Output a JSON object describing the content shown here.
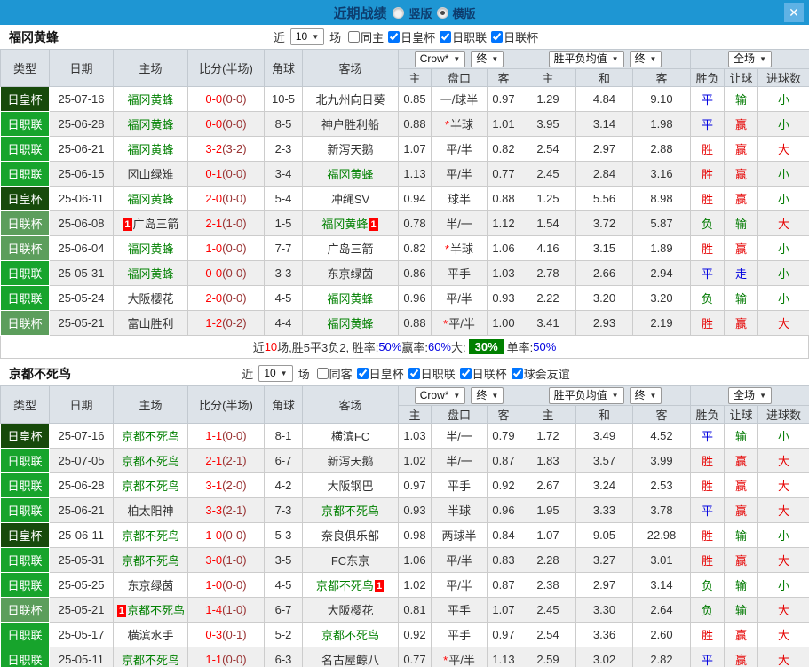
{
  "titlebar": {
    "title": "近期战绩",
    "vertical_label": "竖版",
    "horizontal_label": "横版",
    "selected_layout": "横版",
    "close_glyph": "✕"
  },
  "colors": {
    "titlebar_bg": "#1E96D3",
    "close_button_bg": "#5FB2E5",
    "emperor_cup_bg": "#174A0B",
    "j1_league_bg": "#17A42C",
    "league_cup_bg": "#5C9E5C",
    "team_highlight_green": "#008000",
    "fulltime_score_red": "#FF0000",
    "halftime_score_maroon": "#993333",
    "win_red": "#E60000",
    "draw_blue": "#0000E0",
    "lose_green": "#007A00",
    "odds_column_bg": "#FDF8EF",
    "avg_column_bg": "#E8F2F9",
    "header_bg": "#DDE3E9",
    "stripe_gray": "#EFEFEF",
    "summary_highlight_bg": "#008000"
  },
  "table_header": {
    "main_cols": [
      "类型",
      "日期",
      "主场",
      "比分(半场)",
      "角球",
      "客场"
    ],
    "groups": [
      {
        "name": "odds",
        "dropdown": "Crow*",
        "dropdown2": "终",
        "subs": [
          "主",
          "盘口",
          "客"
        ]
      },
      {
        "name": "avg",
        "dropdown": "胜平负均值",
        "dropdown2": "终",
        "subs": [
          "主",
          "和",
          "客"
        ]
      },
      {
        "name": "scope",
        "dropdown": "全场",
        "dropdown2": null,
        "subs": [
          "胜负",
          "让球",
          "进球数"
        ]
      }
    ]
  },
  "sections": [
    {
      "team": "福冈黄蜂",
      "filter": {
        "near_label": "近",
        "count": "10",
        "unit_label": "场",
        "same": {
          "label": "同主",
          "checked": false
        },
        "leagues": [
          {
            "label": "日皇杯",
            "checked": true
          },
          {
            "label": "日职联",
            "checked": true
          },
          {
            "label": "日联杯",
            "checked": true
          }
        ]
      },
      "rows": [
        {
          "lc": "cup",
          "league": "日皇杯",
          "date": "25-07-16",
          "home": {
            "n": "福冈黄蜂",
            "g": true
          },
          "ft": "0-0",
          "ht": "(0-0)",
          "cn": "10-5",
          "away": {
            "n": "北九州向日葵",
            "g": false
          },
          "o1": "0.85",
          "pk": "一/球半",
          "pks": false,
          "o2": "0.97",
          "a1": "1.29",
          "a2": "4.84",
          "a3": "9.10",
          "r1": {
            "t": "平",
            "c": "b"
          },
          "r2": {
            "t": "输",
            "c": "g"
          },
          "r3": {
            "t": "小",
            "c": "g"
          }
        },
        {
          "lc": "jzl",
          "league": "日职联",
          "date": "25-06-28",
          "home": {
            "n": "福冈黄蜂",
            "g": true
          },
          "ft": "0-0",
          "ht": "(0-0)",
          "cn": "8-5",
          "away": {
            "n": "神户胜利船",
            "g": false
          },
          "o1": "0.88",
          "pk": "半球",
          "pks": true,
          "o2": "1.01",
          "a1": "3.95",
          "a2": "3.14",
          "a3": "1.98",
          "r1": {
            "t": "平",
            "c": "b"
          },
          "r2": {
            "t": "赢",
            "c": "r"
          },
          "r3": {
            "t": "小",
            "c": "g"
          }
        },
        {
          "lc": "jzl",
          "league": "日职联",
          "date": "25-06-21",
          "home": {
            "n": "福冈黄蜂",
            "g": true
          },
          "ft": "3-2",
          "ht": "(3-2)",
          "cn": "2-3",
          "away": {
            "n": "新泻天鹅",
            "g": false
          },
          "o1": "1.07",
          "pk": "平/半",
          "pks": false,
          "o2": "0.82",
          "a1": "2.54",
          "a2": "2.97",
          "a3": "2.88",
          "r1": {
            "t": "胜",
            "c": "r"
          },
          "r2": {
            "t": "赢",
            "c": "r"
          },
          "r3": {
            "t": "大",
            "c": "r"
          }
        },
        {
          "lc": "jzl",
          "league": "日职联",
          "date": "25-06-15",
          "home": {
            "n": "冈山绿雉",
            "g": false
          },
          "ft": "0-1",
          "ht": "(0-0)",
          "cn": "3-4",
          "away": {
            "n": "福冈黄蜂",
            "g": true
          },
          "o1": "1.13",
          "pk": "平/半",
          "pks": false,
          "o2": "0.77",
          "a1": "2.45",
          "a2": "2.84",
          "a3": "3.16",
          "r1": {
            "t": "胜",
            "c": "r"
          },
          "r2": {
            "t": "赢",
            "c": "r"
          },
          "r3": {
            "t": "小",
            "c": "g"
          }
        },
        {
          "lc": "cup",
          "league": "日皇杯",
          "date": "25-06-11",
          "home": {
            "n": "福冈黄蜂",
            "g": true
          },
          "ft": "2-0",
          "ht": "(0-0)",
          "cn": "5-4",
          "away": {
            "n": "冲绳SV",
            "g": false
          },
          "o1": "0.94",
          "pk": "球半",
          "pks": false,
          "o2": "0.88",
          "a1": "1.25",
          "a2": "5.56",
          "a3": "8.98",
          "r1": {
            "t": "胜",
            "c": "r"
          },
          "r2": {
            "t": "赢",
            "c": "r"
          },
          "r3": {
            "t": "小",
            "c": "g"
          }
        },
        {
          "lc": "jlb",
          "league": "日联杯",
          "date": "25-06-08",
          "home": {
            "n": "广岛三箭",
            "g": false,
            "b": "1"
          },
          "ft": "2-1",
          "ht": "(1-0)",
          "cn": "1-5",
          "away": {
            "n": "福冈黄蜂",
            "g": true,
            "b": "1"
          },
          "o1": "0.78",
          "pk": "半/一",
          "pks": false,
          "o2": "1.12",
          "a1": "1.54",
          "a2": "3.72",
          "a3": "5.87",
          "r1": {
            "t": "负",
            "c": "g"
          },
          "r2": {
            "t": "输",
            "c": "g"
          },
          "r3": {
            "t": "大",
            "c": "r"
          }
        },
        {
          "lc": "jlb",
          "league": "日联杯",
          "date": "25-06-04",
          "home": {
            "n": "福冈黄蜂",
            "g": true
          },
          "ft": "1-0",
          "ht": "(0-0)",
          "cn": "7-7",
          "away": {
            "n": "广岛三箭",
            "g": false
          },
          "o1": "0.82",
          "pk": "半球",
          "pks": true,
          "o2": "1.06",
          "a1": "4.16",
          "a2": "3.15",
          "a3": "1.89",
          "r1": {
            "t": "胜",
            "c": "r"
          },
          "r2": {
            "t": "赢",
            "c": "r"
          },
          "r3": {
            "t": "小",
            "c": "g"
          }
        },
        {
          "lc": "jzl",
          "league": "日职联",
          "date": "25-05-31",
          "home": {
            "n": "福冈黄蜂",
            "g": true
          },
          "ft": "0-0",
          "ht": "(0-0)",
          "cn": "3-3",
          "away": {
            "n": "东京绿茵",
            "g": false
          },
          "o1": "0.86",
          "pk": "平手",
          "pks": false,
          "o2": "1.03",
          "a1": "2.78",
          "a2": "2.66",
          "a3": "2.94",
          "r1": {
            "t": "平",
            "c": "b"
          },
          "r2": {
            "t": "走",
            "c": "b"
          },
          "r3": {
            "t": "小",
            "c": "g"
          }
        },
        {
          "lc": "jzl",
          "league": "日职联",
          "date": "25-05-24",
          "home": {
            "n": "大阪樱花",
            "g": false
          },
          "ft": "2-0",
          "ht": "(0-0)",
          "cn": "4-5",
          "away": {
            "n": "福冈黄蜂",
            "g": true
          },
          "o1": "0.96",
          "pk": "平/半",
          "pks": false,
          "o2": "0.93",
          "a1": "2.22",
          "a2": "3.20",
          "a3": "3.20",
          "r1": {
            "t": "负",
            "c": "g"
          },
          "r2": {
            "t": "输",
            "c": "g"
          },
          "r3": {
            "t": "小",
            "c": "g"
          }
        },
        {
          "lc": "jlb",
          "league": "日联杯",
          "date": "25-05-21",
          "home": {
            "n": "富山胜利",
            "g": false
          },
          "ft": "1-2",
          "ht": "(0-2)",
          "cn": "4-4",
          "away": {
            "n": "福冈黄蜂",
            "g": true
          },
          "o1": "0.88",
          "pk": "平/半",
          "pks": true,
          "o2": "1.00",
          "a1": "3.41",
          "a2": "2.93",
          "a3": "2.19",
          "r1": {
            "t": "胜",
            "c": "r"
          },
          "r2": {
            "t": "赢",
            "c": "r"
          },
          "r3": {
            "t": "大",
            "c": "r"
          }
        }
      ],
      "summary": [
        {
          "t": "近",
          "c": "k"
        },
        {
          "t": "10",
          "c": "r"
        },
        {
          "t": "场,胜5平3负2, 胜率:",
          "c": "k"
        },
        {
          "t": "50%",
          "c": "b"
        },
        {
          "t": " 赢率:",
          "c": "k"
        },
        {
          "t": "60%",
          "c": "b"
        },
        {
          "t": " 大:",
          "c": "k"
        },
        {
          "t": "30%",
          "c": "gb"
        },
        {
          "t": " 单率:",
          "c": "k"
        },
        {
          "t": "50%",
          "c": "b"
        }
      ]
    },
    {
      "team": "京都不死鸟",
      "filter": {
        "near_label": "近",
        "count": "10",
        "unit_label": "场",
        "same": {
          "label": "同客",
          "checked": false
        },
        "leagues": [
          {
            "label": "日皇杯",
            "checked": true
          },
          {
            "label": "日职联",
            "checked": true
          },
          {
            "label": "日联杯",
            "checked": true
          },
          {
            "label": "球会友谊",
            "checked": true
          }
        ]
      },
      "rows": [
        {
          "lc": "cup",
          "league": "日皇杯",
          "date": "25-07-16",
          "home": {
            "n": "京都不死鸟",
            "g": true
          },
          "ft": "1-1",
          "ht": "(0-0)",
          "cn": "8-1",
          "away": {
            "n": "横滨FC",
            "g": false
          },
          "o1": "1.03",
          "pk": "半/一",
          "pks": false,
          "o2": "0.79",
          "a1": "1.72",
          "a2": "3.49",
          "a3": "4.52",
          "r1": {
            "t": "平",
            "c": "b"
          },
          "r2": {
            "t": "输",
            "c": "g"
          },
          "r3": {
            "t": "小",
            "c": "g"
          }
        },
        {
          "lc": "jzl",
          "league": "日职联",
          "date": "25-07-05",
          "home": {
            "n": "京都不死鸟",
            "g": true
          },
          "ft": "2-1",
          "ht": "(2-1)",
          "cn": "6-7",
          "away": {
            "n": "新泻天鹅",
            "g": false
          },
          "o1": "1.02",
          "pk": "半/一",
          "pks": false,
          "o2": "0.87",
          "a1": "1.83",
          "a2": "3.57",
          "a3": "3.99",
          "r1": {
            "t": "胜",
            "c": "r"
          },
          "r2": {
            "t": "赢",
            "c": "r"
          },
          "r3": {
            "t": "大",
            "c": "r"
          }
        },
        {
          "lc": "jzl",
          "league": "日职联",
          "date": "25-06-28",
          "home": {
            "n": "京都不死鸟",
            "g": true
          },
          "ft": "3-1",
          "ht": "(2-0)",
          "cn": "4-2",
          "away": {
            "n": "大阪钢巴",
            "g": false
          },
          "o1": "0.97",
          "pk": "平手",
          "pks": false,
          "o2": "0.92",
          "a1": "2.67",
          "a2": "3.24",
          "a3": "2.53",
          "r1": {
            "t": "胜",
            "c": "r"
          },
          "r2": {
            "t": "赢",
            "c": "r"
          },
          "r3": {
            "t": "大",
            "c": "r"
          }
        },
        {
          "lc": "jzl",
          "league": "日职联",
          "date": "25-06-21",
          "home": {
            "n": "柏太阳神",
            "g": false
          },
          "ft": "3-3",
          "ht": "(2-1)",
          "cn": "7-3",
          "away": {
            "n": "京都不死鸟",
            "g": true
          },
          "o1": "0.93",
          "pk": "半球",
          "pks": false,
          "o2": "0.96",
          "a1": "1.95",
          "a2": "3.33",
          "a3": "3.78",
          "r1": {
            "t": "平",
            "c": "b"
          },
          "r2": {
            "t": "赢",
            "c": "r"
          },
          "r3": {
            "t": "大",
            "c": "r"
          }
        },
        {
          "lc": "cup",
          "league": "日皇杯",
          "date": "25-06-11",
          "home": {
            "n": "京都不死鸟",
            "g": true
          },
          "ft": "1-0",
          "ht": "(0-0)",
          "cn": "5-3",
          "away": {
            "n": "奈良俱乐部",
            "g": false
          },
          "o1": "0.98",
          "pk": "两球半",
          "pks": false,
          "o2": "0.84",
          "a1": "1.07",
          "a2": "9.05",
          "a3": "22.98",
          "r1": {
            "t": "胜",
            "c": "r"
          },
          "r2": {
            "t": "输",
            "c": "g"
          },
          "r3": {
            "t": "小",
            "c": "g"
          }
        },
        {
          "lc": "jzl",
          "league": "日职联",
          "date": "25-05-31",
          "home": {
            "n": "京都不死鸟",
            "g": true
          },
          "ft": "3-0",
          "ht": "(1-0)",
          "cn": "3-5",
          "away": {
            "n": "FC东京",
            "g": false
          },
          "o1": "1.06",
          "pk": "平/半",
          "pks": false,
          "o2": "0.83",
          "a1": "2.28",
          "a2": "3.27",
          "a3": "3.01",
          "r1": {
            "t": "胜",
            "c": "r"
          },
          "r2": {
            "t": "赢",
            "c": "r"
          },
          "r3": {
            "t": "大",
            "c": "r"
          }
        },
        {
          "lc": "jzl",
          "league": "日职联",
          "date": "25-05-25",
          "home": {
            "n": "东京绿茵",
            "g": false
          },
          "ft": "1-0",
          "ht": "(0-0)",
          "cn": "4-5",
          "away": {
            "n": "京都不死鸟",
            "g": true,
            "b": "1"
          },
          "o1": "1.02",
          "pk": "平/半",
          "pks": false,
          "o2": "0.87",
          "a1": "2.38",
          "a2": "2.97",
          "a3": "3.14",
          "r1": {
            "t": "负",
            "c": "g"
          },
          "r2": {
            "t": "输",
            "c": "g"
          },
          "r3": {
            "t": "小",
            "c": "g"
          }
        },
        {
          "lc": "jlb",
          "league": "日联杯",
          "date": "25-05-21",
          "home": {
            "n": "京都不死鸟",
            "g": true,
            "b": "1"
          },
          "ft": "1-4",
          "ht": "(1-0)",
          "cn": "6-7",
          "away": {
            "n": "大阪樱花",
            "g": false
          },
          "o1": "0.81",
          "pk": "平手",
          "pks": false,
          "o2": "1.07",
          "a1": "2.45",
          "a2": "3.30",
          "a3": "2.64",
          "r1": {
            "t": "负",
            "c": "g"
          },
          "r2": {
            "t": "输",
            "c": "g"
          },
          "r3": {
            "t": "大",
            "c": "r"
          }
        },
        {
          "lc": "jzl",
          "league": "日职联",
          "date": "25-05-17",
          "home": {
            "n": "横滨水手",
            "g": false
          },
          "ft": "0-3",
          "ht": "(0-1)",
          "cn": "5-2",
          "away": {
            "n": "京都不死鸟",
            "g": true
          },
          "o1": "0.92",
          "pk": "平手",
          "pks": false,
          "o2": "0.97",
          "a1": "2.54",
          "a2": "3.36",
          "a3": "2.60",
          "r1": {
            "t": "胜",
            "c": "r"
          },
          "r2": {
            "t": "赢",
            "c": "r"
          },
          "r3": {
            "t": "大",
            "c": "r"
          }
        },
        {
          "lc": "jzl",
          "league": "日职联",
          "date": "25-05-11",
          "home": {
            "n": "京都不死鸟",
            "g": true
          },
          "ft": "1-1",
          "ht": "(0-0)",
          "cn": "6-3",
          "away": {
            "n": "名古屋鲸八",
            "g": false
          },
          "o1": "0.77",
          "pk": "平/半",
          "pks": true,
          "o2": "1.13",
          "a1": "2.59",
          "a2": "3.02",
          "a3": "2.82",
          "r1": {
            "t": "平",
            "c": "b"
          },
          "r2": {
            "t": "赢",
            "c": "r"
          },
          "r3": {
            "t": "大",
            "c": "r"
          }
        }
      ],
      "summary": null
    }
  ]
}
